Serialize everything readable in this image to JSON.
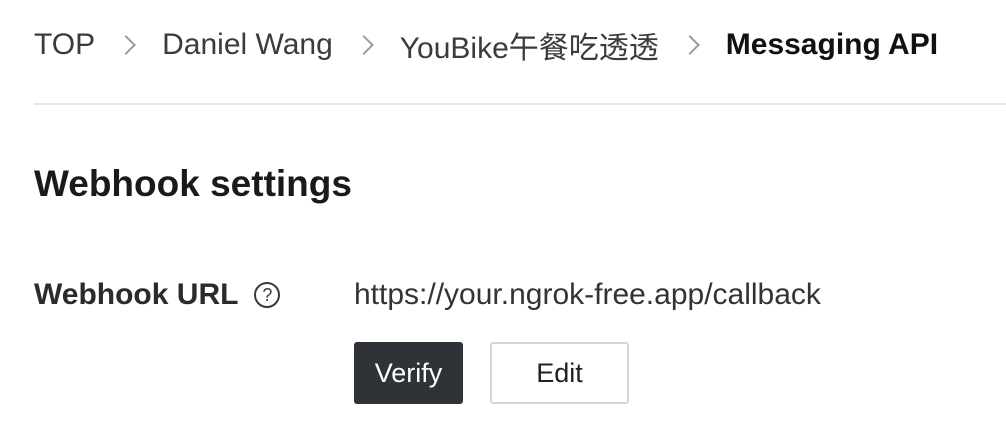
{
  "breadcrumb": {
    "items": [
      {
        "label": "TOP"
      },
      {
        "label": "Daniel Wang"
      },
      {
        "label": "YouBike午餐吃透透"
      },
      {
        "label": "Messaging API"
      }
    ]
  },
  "section": {
    "title": "Webhook settings"
  },
  "webhook": {
    "label": "Webhook URL",
    "help_icon": "?",
    "url": "https://your.ngrok-free.app/callback",
    "verify_label": "Verify",
    "edit_label": "Edit"
  },
  "colors": {
    "primary_button": "#2f3237",
    "divider": "#e6e6e6"
  },
  "icons": {
    "breadcrumb_separator": "chevron-right-icon",
    "help": "question-circle-icon"
  }
}
